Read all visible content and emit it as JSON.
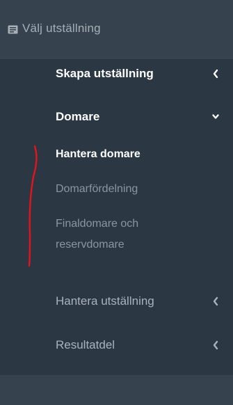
{
  "header": {
    "label": "Välj utställning",
    "icon": "id-card-icon"
  },
  "nav": {
    "items": [
      {
        "label": "Skapa utställning",
        "chevron": "left"
      },
      {
        "label": "Domare",
        "chevron": "down"
      },
      {
        "label": "Hantera utställning",
        "chevron": "left"
      },
      {
        "label": "Resultatdel",
        "chevron": "left"
      }
    ],
    "sub_items": [
      {
        "label": "Hantera domare",
        "active": true
      },
      {
        "label": "Domarfördelning",
        "active": false
      },
      {
        "label": "Finaldomare och reservdomare",
        "active": false
      }
    ]
  },
  "colors": {
    "sidebar_bg": "#2b3743",
    "header_bg": "#36424d",
    "active_text": "#ffffff",
    "muted_text": "#aab3bb",
    "annotation": "#e3141b"
  }
}
